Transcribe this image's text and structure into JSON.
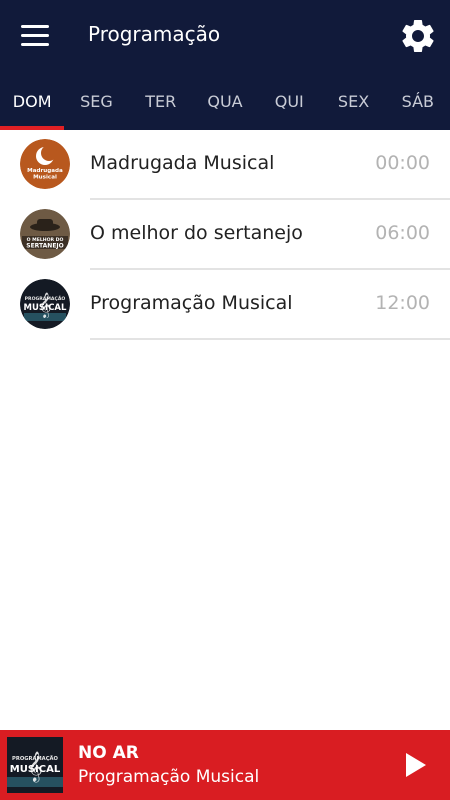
{
  "appbar": {
    "title": "Programação",
    "menu_icon": "hamburger-menu-icon",
    "settings_icon": "gear-icon"
  },
  "tabs": [
    {
      "label": "DOM",
      "active": true
    },
    {
      "label": "SEG",
      "active": false
    },
    {
      "label": "TER",
      "active": false
    },
    {
      "label": "QUA",
      "active": false
    },
    {
      "label": "QUI",
      "active": false
    },
    {
      "label": "SEX",
      "active": false
    },
    {
      "label": "SÁB",
      "active": false
    }
  ],
  "schedule": [
    {
      "title": "Madrugada Musical",
      "time": "00:00",
      "thumb_text": [
        "Madrugada",
        "Musical"
      ]
    },
    {
      "title": "O melhor do sertanejo",
      "time": "06:00",
      "thumb_text": [
        "O MELHOR DO",
        "SERTANEJO"
      ]
    },
    {
      "title": "Programação Musical",
      "time": "12:00",
      "thumb_text": [
        "PROGRAMAÇÃO",
        "MUSICAL"
      ]
    }
  ],
  "player": {
    "status": "NO AR",
    "now_playing": "Programação Musical",
    "art_text": [
      "PROGRAMAÇÃO",
      "MUSICAL"
    ],
    "play_icon": "play-icon"
  },
  "colors": {
    "appbar_bg": "#111a3a",
    "accent_red": "#e12024",
    "player_bg": "#d91d22",
    "time_gray": "#b3b3b3"
  }
}
